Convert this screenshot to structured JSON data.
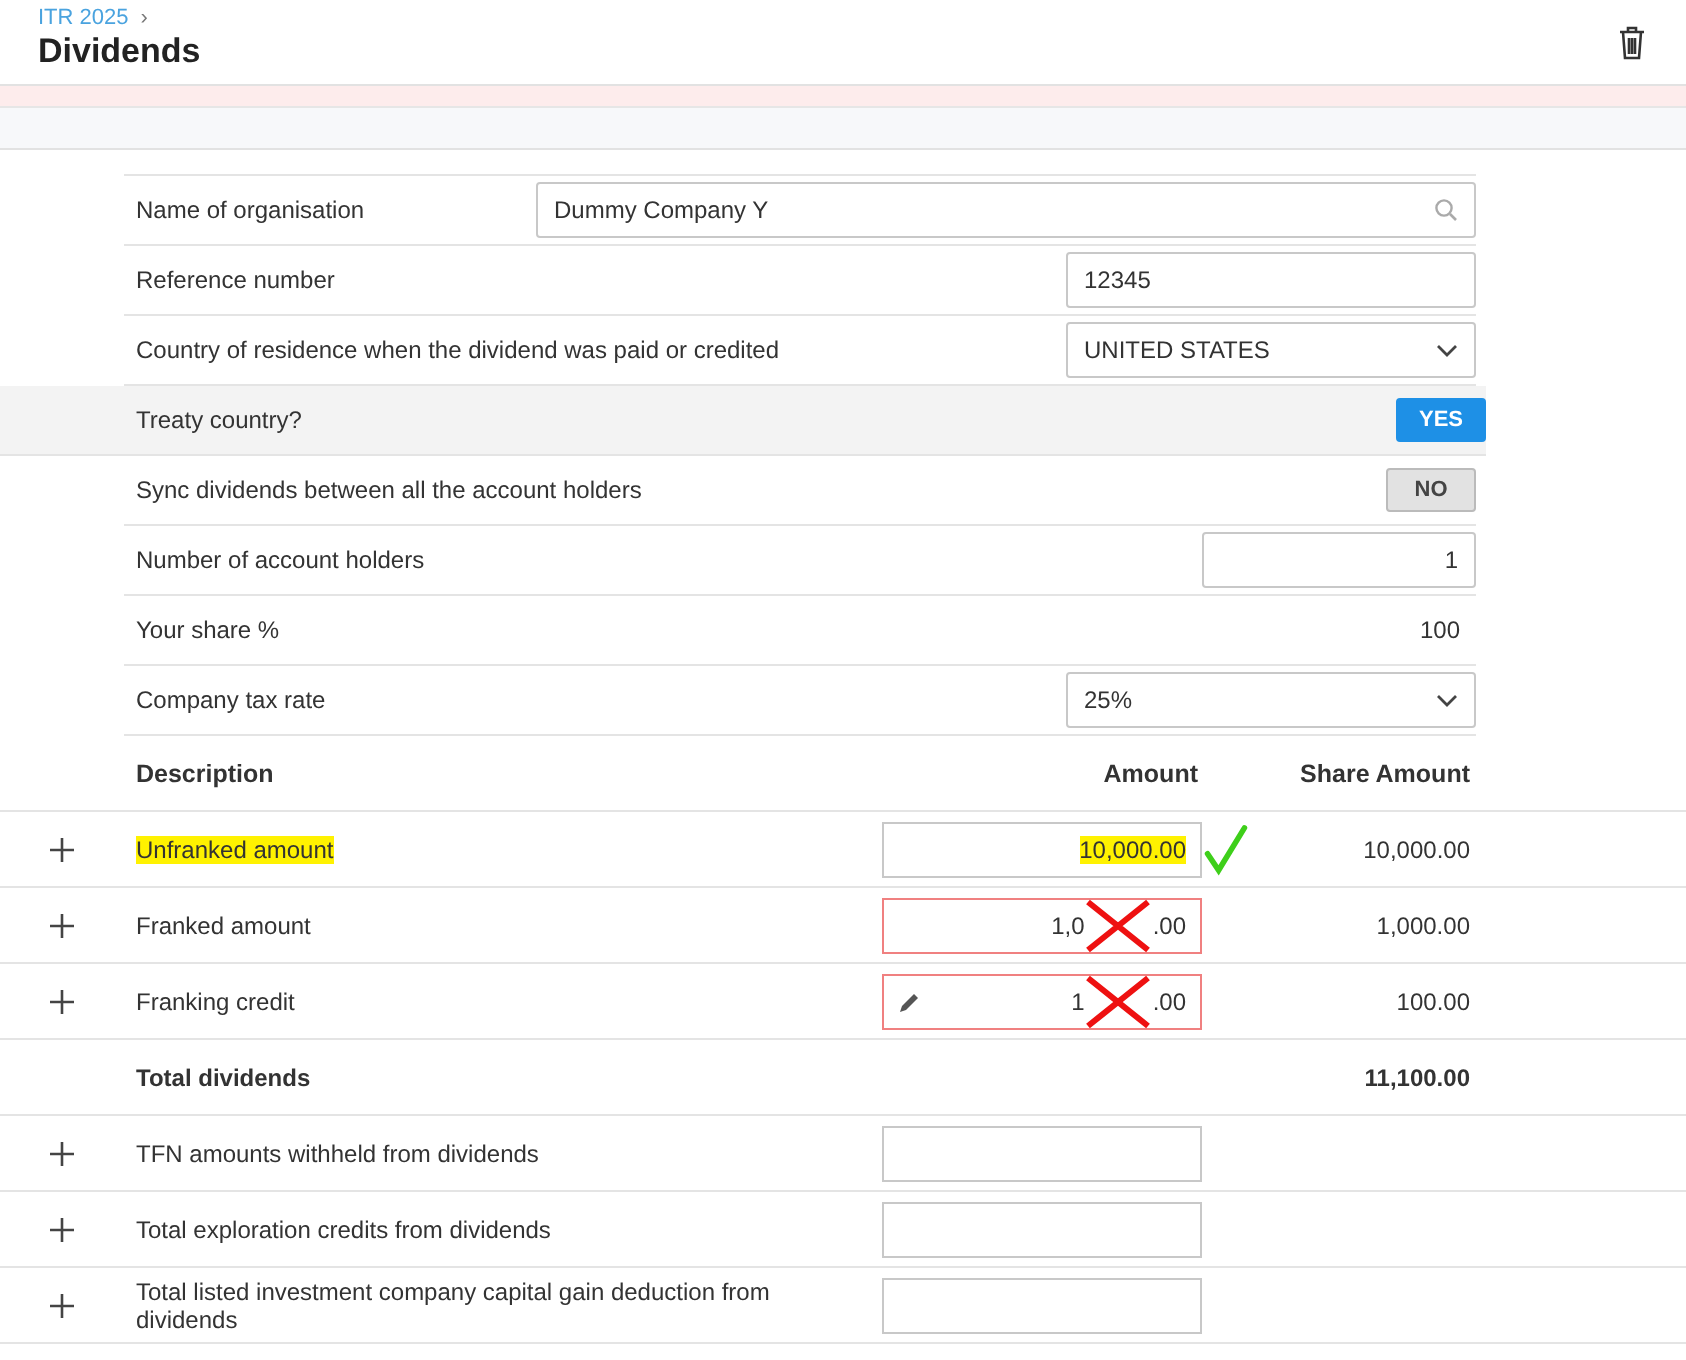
{
  "breadcrumb": {
    "label": "ITR 2025",
    "separator": "›"
  },
  "title": "Dividends",
  "fields": [
    {
      "kind": "search",
      "label": "Name of organisation",
      "value": "Dummy Company Y",
      "shaded": false
    },
    {
      "kind": "text",
      "label": "Reference number",
      "value": "12345",
      "shaded": false
    },
    {
      "kind": "select",
      "label": "Country of residence when the dividend was paid or credited",
      "value": "UNITED STATES",
      "shaded": false
    },
    {
      "kind": "toggle",
      "label": "Treaty country?",
      "value": "YES",
      "on": true,
      "shaded": true
    },
    {
      "kind": "toggle",
      "label": "Sync dividends between all the account holders",
      "value": "NO",
      "on": false,
      "shaded": false
    },
    {
      "kind": "number",
      "label": "Number of account holders",
      "value": "1",
      "shaded": false
    },
    {
      "kind": "plain",
      "label": "Your share %",
      "value": "100",
      "shaded": false
    },
    {
      "kind": "select",
      "label": "Company tax rate",
      "value": "25%",
      "shaded": false
    }
  ],
  "table": {
    "columns": [
      "Description",
      "Amount",
      "Share Amount"
    ],
    "rows": [
      {
        "kind": "amount",
        "label": "Unfranked amount",
        "value_parts": [
          "10,000.00"
        ],
        "share": "10,000.00",
        "highlighted": true,
        "invalid": false,
        "editable": false,
        "ticked": true,
        "crossed": false
      },
      {
        "kind": "amount",
        "label": "Franked amount",
        "value_parts": [
          "1,0",
          ".00"
        ],
        "share": "1,000.00",
        "highlighted": false,
        "invalid": true,
        "editable": false,
        "ticked": false,
        "crossed": true
      },
      {
        "kind": "amount",
        "label": "Franking credit",
        "value_parts": [
          "1",
          ".00"
        ],
        "share": "100.00",
        "highlighted": false,
        "invalid": true,
        "editable": true,
        "ticked": false,
        "crossed": true
      },
      {
        "kind": "total",
        "label": "Total dividends",
        "share": "11,100.00"
      },
      {
        "kind": "amount",
        "label": "TFN amounts withheld from dividends",
        "highlighted": false,
        "invalid": false,
        "editable": false
      },
      {
        "kind": "amount",
        "label": "Total exploration credits from dividends",
        "highlighted": false,
        "invalid": false,
        "editable": false
      },
      {
        "kind": "amount",
        "label": "Total listed investment company capital gain deduction from dividends",
        "highlighted": false,
        "invalid": false,
        "editable": false
      }
    ]
  }
}
